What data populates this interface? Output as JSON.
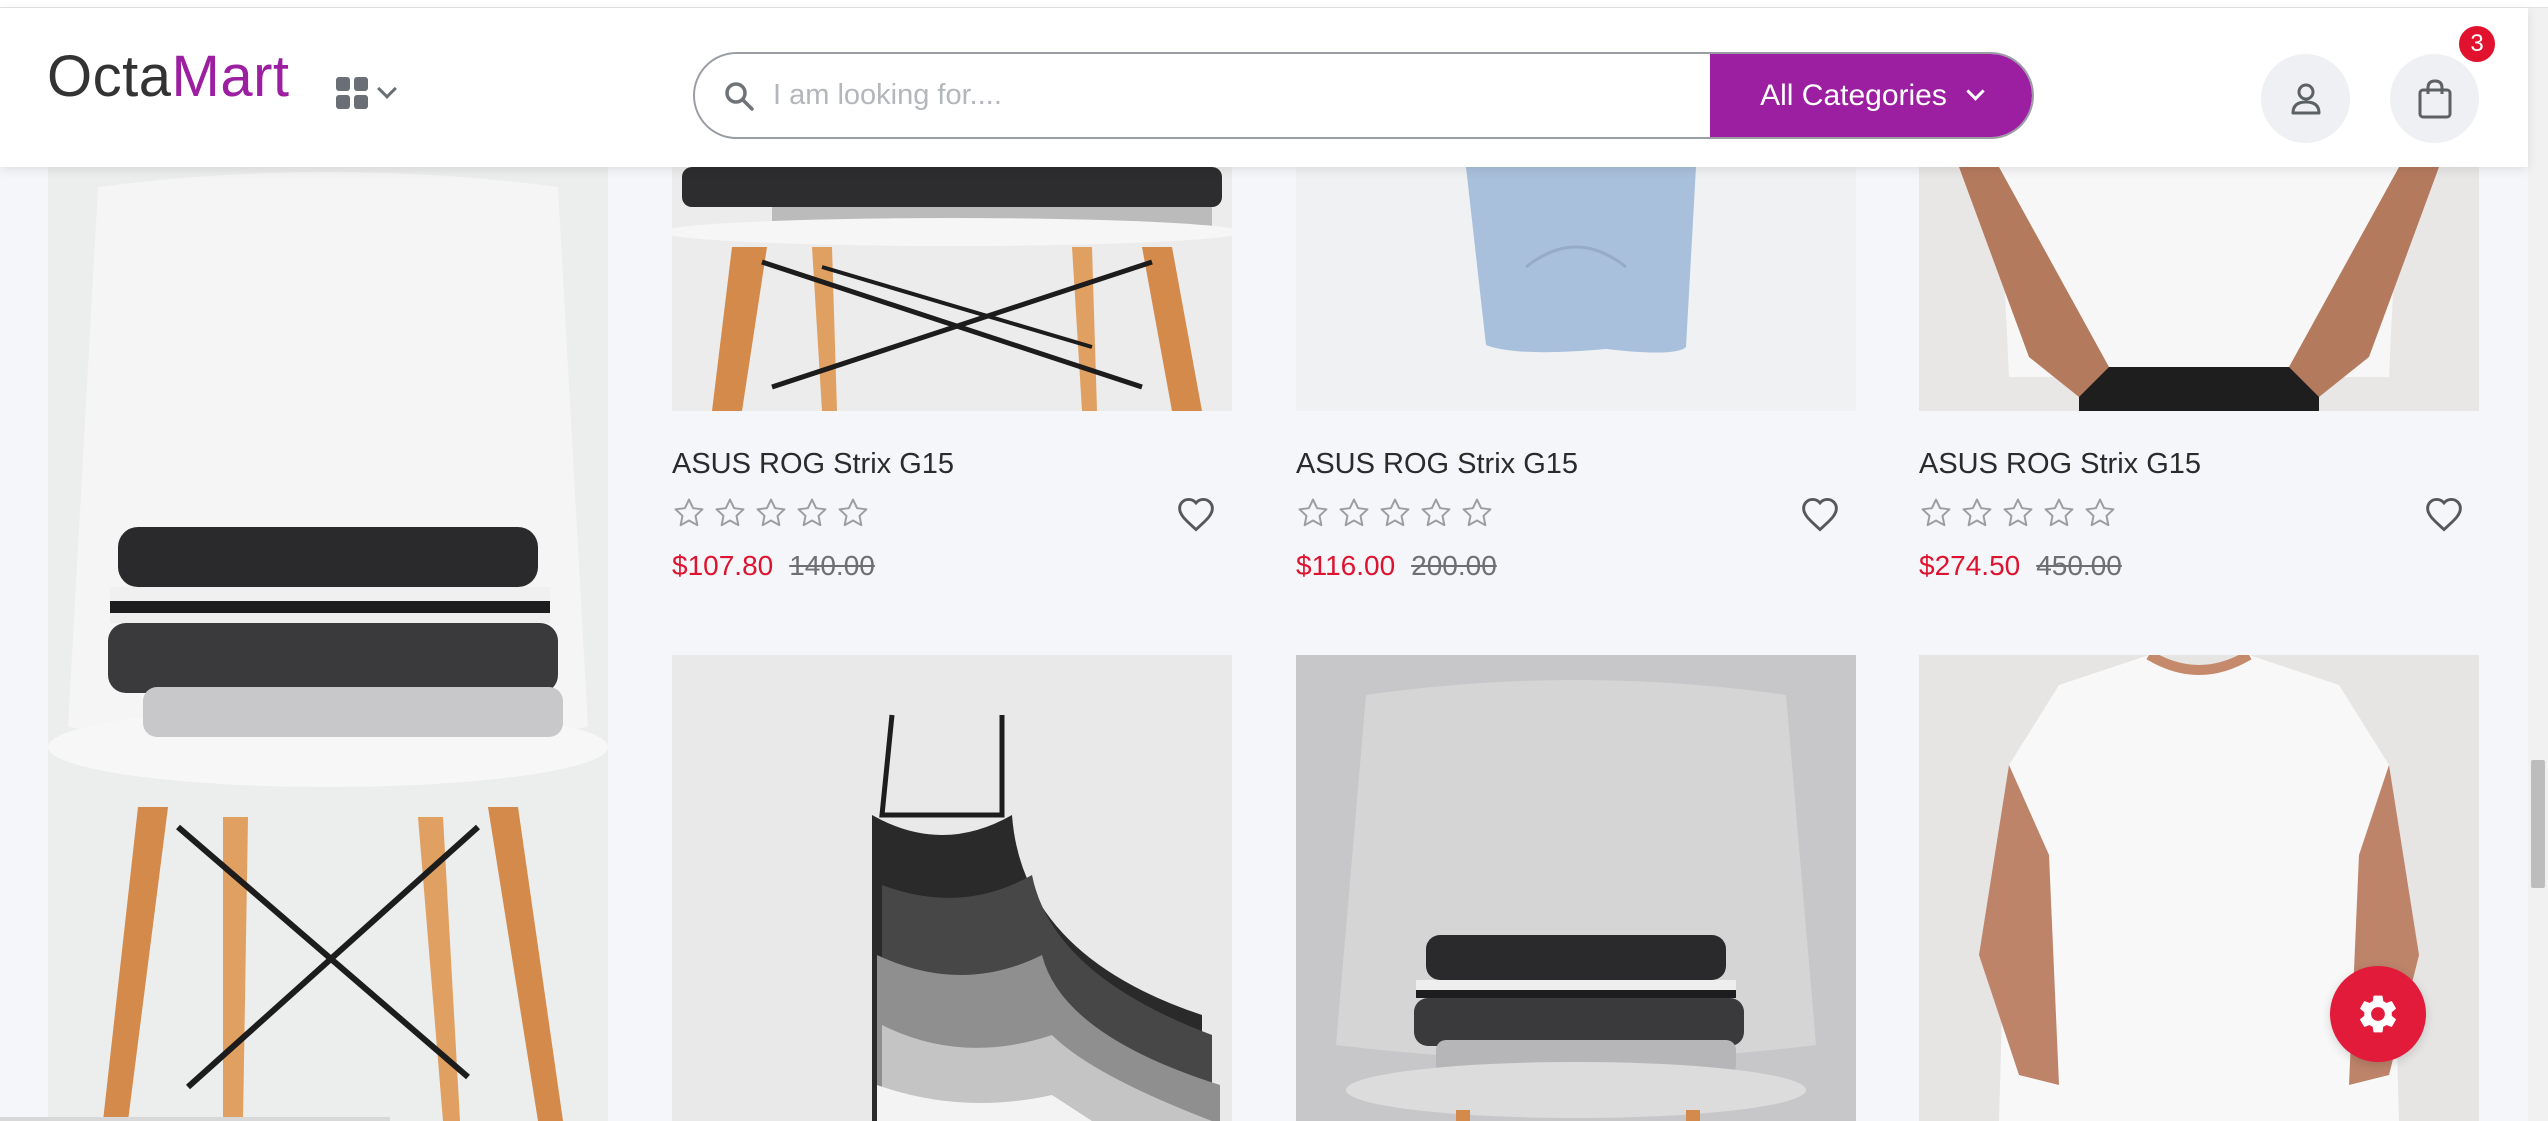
{
  "header": {
    "logo_part1": "Octa",
    "logo_part2": "Mart",
    "menu_icon": "grid-icon",
    "search": {
      "placeholder": "I am looking for....",
      "icon": "search-icon"
    },
    "categories_label": "All Categories",
    "account_icon": "user-icon",
    "cart_icon": "shopping-bag-icon",
    "cart_count": "3"
  },
  "colors": {
    "accent": "#9b1fa0",
    "price": "#dd1330",
    "badge": "#e0122d",
    "fab": "#e31b3a"
  },
  "products": [
    {
      "title": "ASUS ROG Strix G15",
      "rating": 0,
      "max_rating": 5,
      "price": "$107.80",
      "old_price": "140.00"
    },
    {
      "title": "ASUS ROG Strix G15",
      "rating": 0,
      "max_rating": 5,
      "price": "$116.00",
      "old_price": "200.00"
    },
    {
      "title": "ASUS ROG Strix G15",
      "rating": 0,
      "max_rating": 5,
      "price": "$274.50",
      "old_price": "450.00"
    }
  ],
  "settings_icon": "gear-icon"
}
